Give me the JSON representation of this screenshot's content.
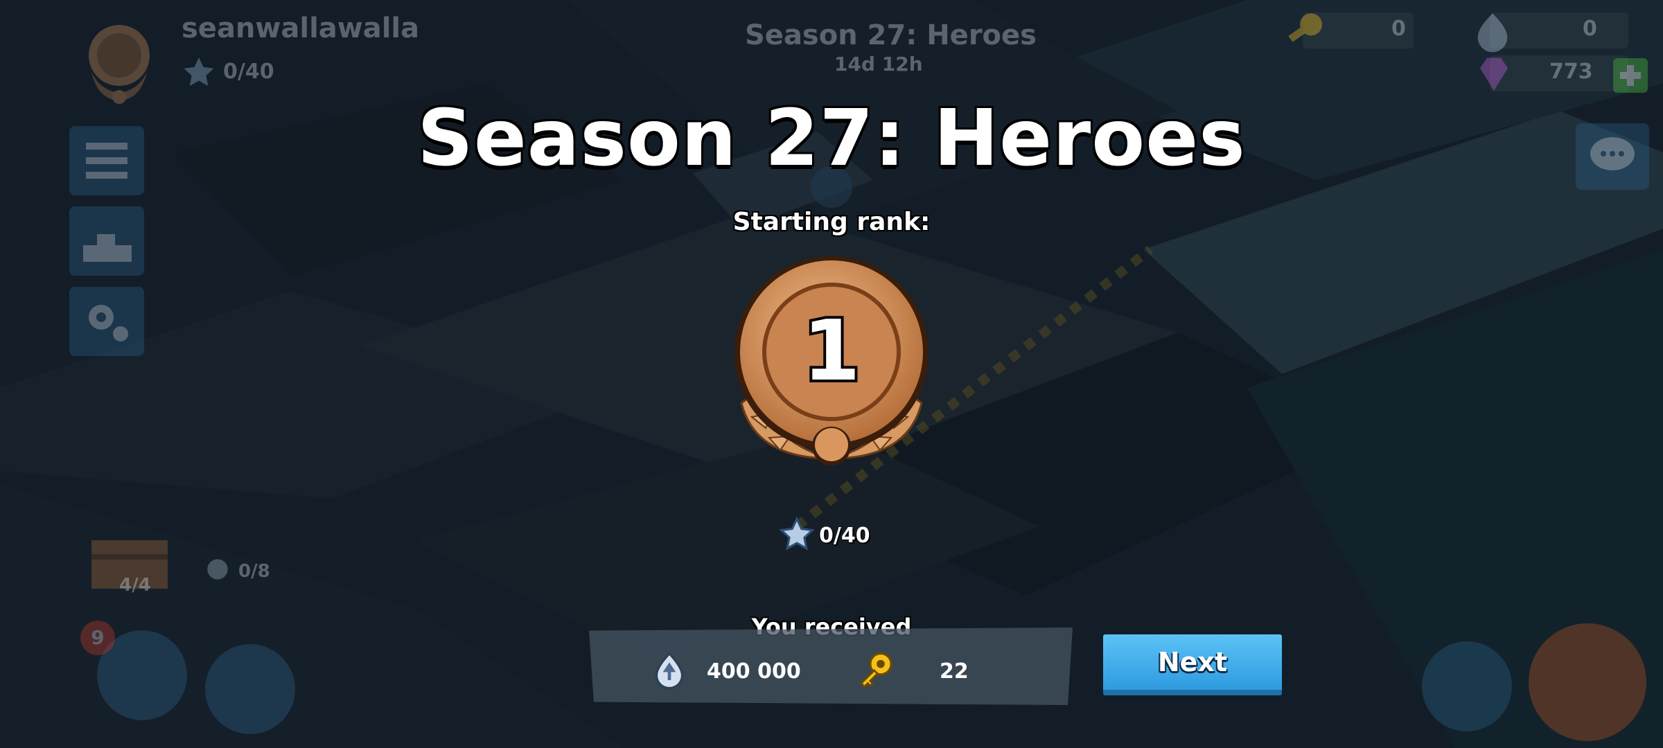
{
  "hud": {
    "username": "seanwallawalla",
    "rank_number": "1",
    "stars": "0/40",
    "season_title": "Season 27: Heroes",
    "season_time": "14d 12h",
    "keys_value": "0",
    "medals_value": "0",
    "diamonds_value": "773",
    "chest_progress": "4/4",
    "parts_progress": "0/8",
    "notification_count": "9",
    "plus_icon": "plus-icon",
    "menu_icon": "hamburger-icon",
    "leaderboard_icon": "podium-icon",
    "settings_icon": "gear-icon",
    "chat_icon": "chat-bubble-icon"
  },
  "overlay": {
    "title": "Season 27: Heroes",
    "starting_rank_label": "Starting rank:",
    "rank_number": "1",
    "rank_progress": "0/40",
    "received_label": "You received",
    "rewards": [
      {
        "icon": "intel-medal-icon",
        "value": "400 000"
      },
      {
        "icon": "gold-key-icon",
        "value": "22"
      }
    ],
    "next_label": "Next"
  },
  "colors": {
    "medal_bronze": "#d08a52",
    "button_blue": "#3fb0ef",
    "key_gold": "#f2c21a"
  }
}
